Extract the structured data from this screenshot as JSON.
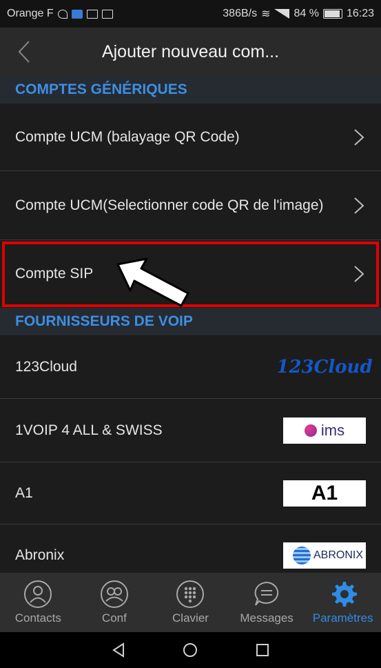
{
  "status": {
    "carrier": "Orange F",
    "speed": "386B/s",
    "battery": "84 %",
    "time": "16:23"
  },
  "toolbar": {
    "title": "Ajouter nouveau com..."
  },
  "sections": {
    "generic": "COMPTES GÉNÉRIQUES",
    "voip": "FOURNISSEURS DE VOIP"
  },
  "generic_items": [
    {
      "label": "Compte UCM (balayage QR Code)"
    },
    {
      "label": "Compte UCM(Selectionner code QR de l'image)"
    },
    {
      "label": "Compte SIP"
    }
  ],
  "providers": [
    {
      "label": "123Cloud",
      "logo": "123Cloud",
      "logo_name": "123cloud-logo"
    },
    {
      "label": "1VOIP 4 ALL & SWISS",
      "logo": "ims",
      "logo_name": "ims-logo"
    },
    {
      "label": "A1",
      "logo": "A1",
      "logo_name": "a1-logo"
    },
    {
      "label": "Abronix",
      "logo": "ABRONIX",
      "logo_name": "abronix-logo"
    }
  ],
  "nav": [
    {
      "label": "Contacts",
      "icon": "contact-icon"
    },
    {
      "label": "Conf",
      "icon": "conference-icon"
    },
    {
      "label": "Clavier",
      "icon": "keypad-icon"
    },
    {
      "label": "Messages",
      "icon": "message-icon"
    },
    {
      "label": "Paramètres",
      "icon": "settings-icon"
    }
  ],
  "colors": {
    "accent": "#2f8ce6",
    "section_text": "#3d8fe3",
    "highlight": "#e00000"
  }
}
